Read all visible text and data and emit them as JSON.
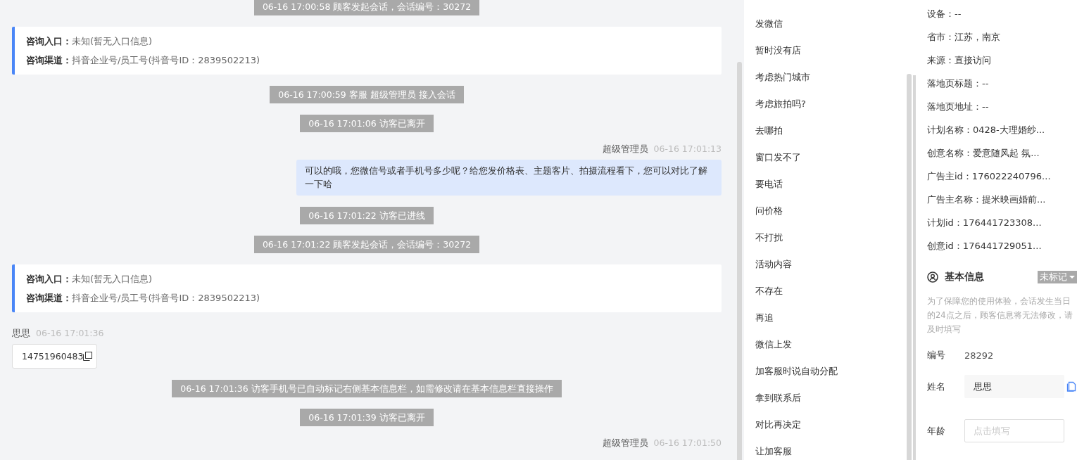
{
  "chat": {
    "messages": [
      {
        "kind": "system",
        "text": "06-16 17:00:58 顾客发起会话，会话编号：30272"
      },
      {
        "kind": "source",
        "entry_label": "咨询入口：",
        "entry": "未知(暂无入口信息)",
        "channel_label": "咨询渠道：",
        "channel": "抖音企业号/员工号(抖音号ID：2839502213)"
      },
      {
        "kind": "system",
        "text": "06-16 17:00:59 客服 超级管理员 接入会话"
      },
      {
        "kind": "system",
        "text": "06-16 17:01:06 访客已离开"
      },
      {
        "kind": "outgoing",
        "sender": "超级管理员",
        "time": "06-16 17:01:13",
        "text": "可以的哦，您微信号或者手机号多少呢？给您发价格表、主题客片、拍摄流程看下，您可以对比了解一下哈"
      },
      {
        "kind": "system",
        "text": "06-16 17:01:22 访客已进线"
      },
      {
        "kind": "system",
        "text": "06-16 17:01:22 顾客发起会话，会话编号：30272"
      },
      {
        "kind": "source",
        "entry_label": "咨询入口：",
        "entry": "未知(暂无入口信息)",
        "channel_label": "咨询渠道：",
        "channel": "抖音企业号/员工号(抖音号ID：2839502213)"
      },
      {
        "kind": "incoming",
        "sender": "思思",
        "time": "06-16 17:01:36",
        "text": "14751960483"
      },
      {
        "kind": "system",
        "text": "06-16 17:01:36 访客手机号已自动标记右侧基本信息栏，如需修改请在基本信息栏直接操作"
      },
      {
        "kind": "system",
        "text": "06-16 17:01:39 访客已离开"
      },
      {
        "kind": "outgoing",
        "sender": "超级管理员",
        "time": "06-16 17:01:50"
      }
    ]
  },
  "quick_replies": [
    "发微信",
    "暂时没有店",
    "考虑热门城市",
    "考虑旅拍吗?",
    "去哪拍",
    "窗口发不了",
    "要电话",
    "问价格",
    "不打扰",
    "活动内容",
    "不存在",
    "再追",
    "微信上发",
    "加客服时说自动分配",
    "拿到联系后",
    "对比再决定",
    "让加客服"
  ],
  "visitor_info": [
    "设备：--",
    "省市：江苏，南京",
    "来源：直接访问",
    "落地页标题：--",
    "落地页地址：--",
    "计划名称：0428-大理婚纱...",
    "创意名称：爱意随风起 氛...",
    "广告主id：176022240796...",
    "广告主名称：提米映画婚前...",
    "计划id：176441723308...",
    "创意id：176441729051..."
  ],
  "basic_info": {
    "title": "基本信息",
    "tag": "未标记",
    "notice": "为了保障您的使用体验，会话发生当日的24点之后，顾客信息将无法修改，请及时填写",
    "fields": [
      {
        "kind": "text",
        "label": "编号",
        "value": "28292"
      },
      {
        "kind": "input",
        "label": "姓名",
        "value": "思思"
      },
      {
        "kind": "input",
        "label": "年龄",
        "placeholder": "点击填写"
      }
    ]
  }
}
